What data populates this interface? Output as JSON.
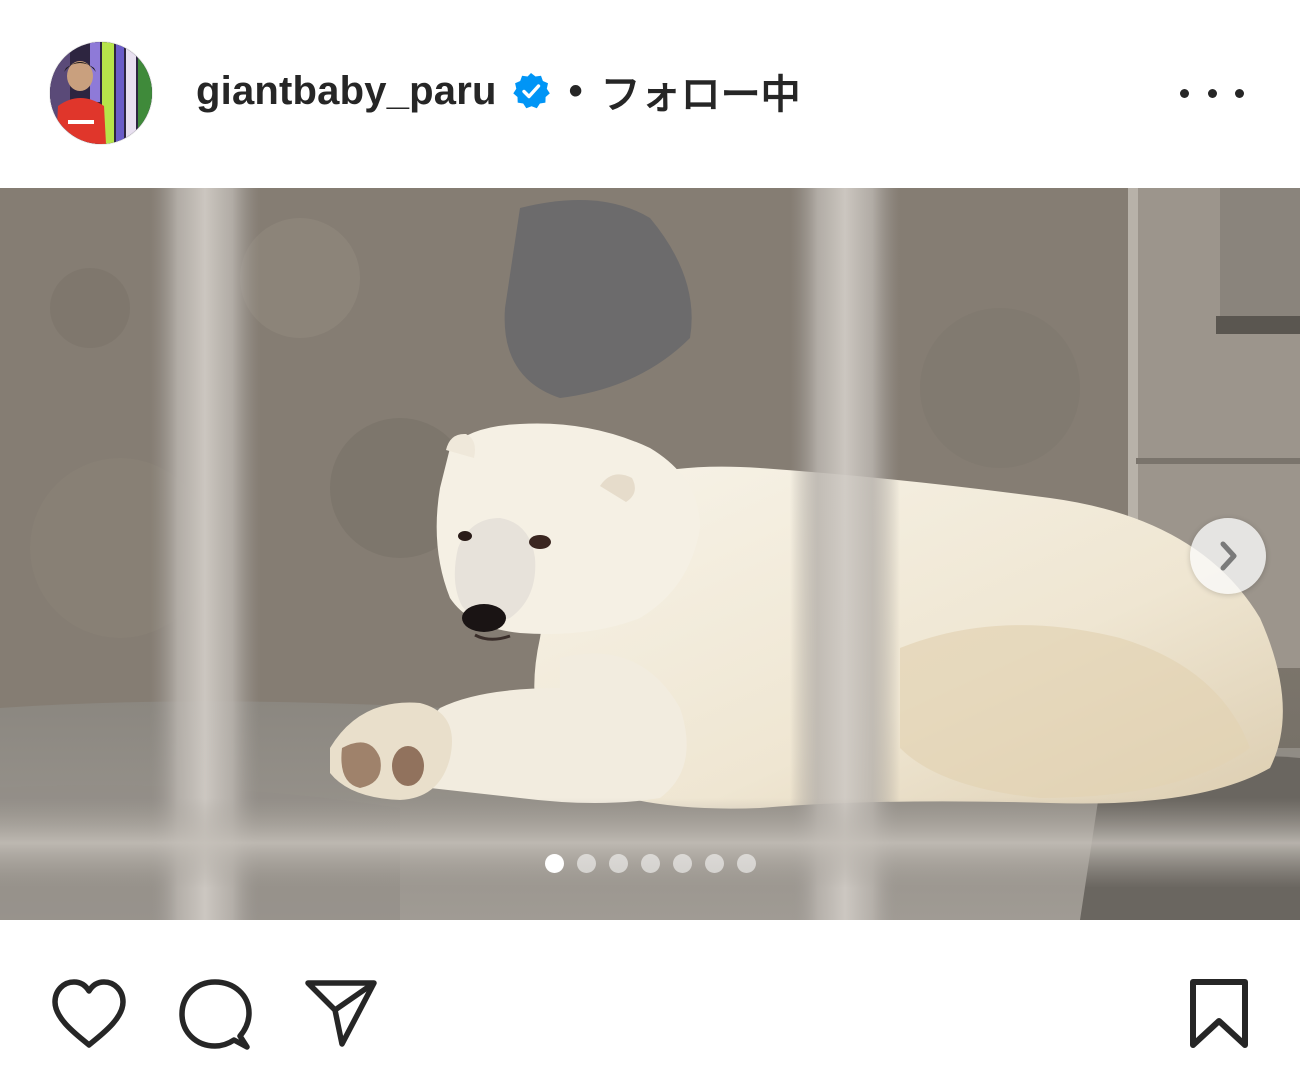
{
  "post": {
    "username": "giantbaby_paru",
    "separator": "•",
    "follow_status": "フォロー中",
    "verified": true,
    "more_icon": "more-horizontal-icon"
  },
  "carousel": {
    "total_slides": 7,
    "current_slide": 1,
    "next_icon": "chevron-right-icon"
  },
  "actions": {
    "like_icon": "heart-icon",
    "comment_icon": "comment-icon",
    "share_icon": "paper-plane-icon",
    "save_icon": "bookmark-icon"
  },
  "colors": {
    "text": "#262626",
    "verified_blue": "#0095f6",
    "background": "#ffffff"
  }
}
